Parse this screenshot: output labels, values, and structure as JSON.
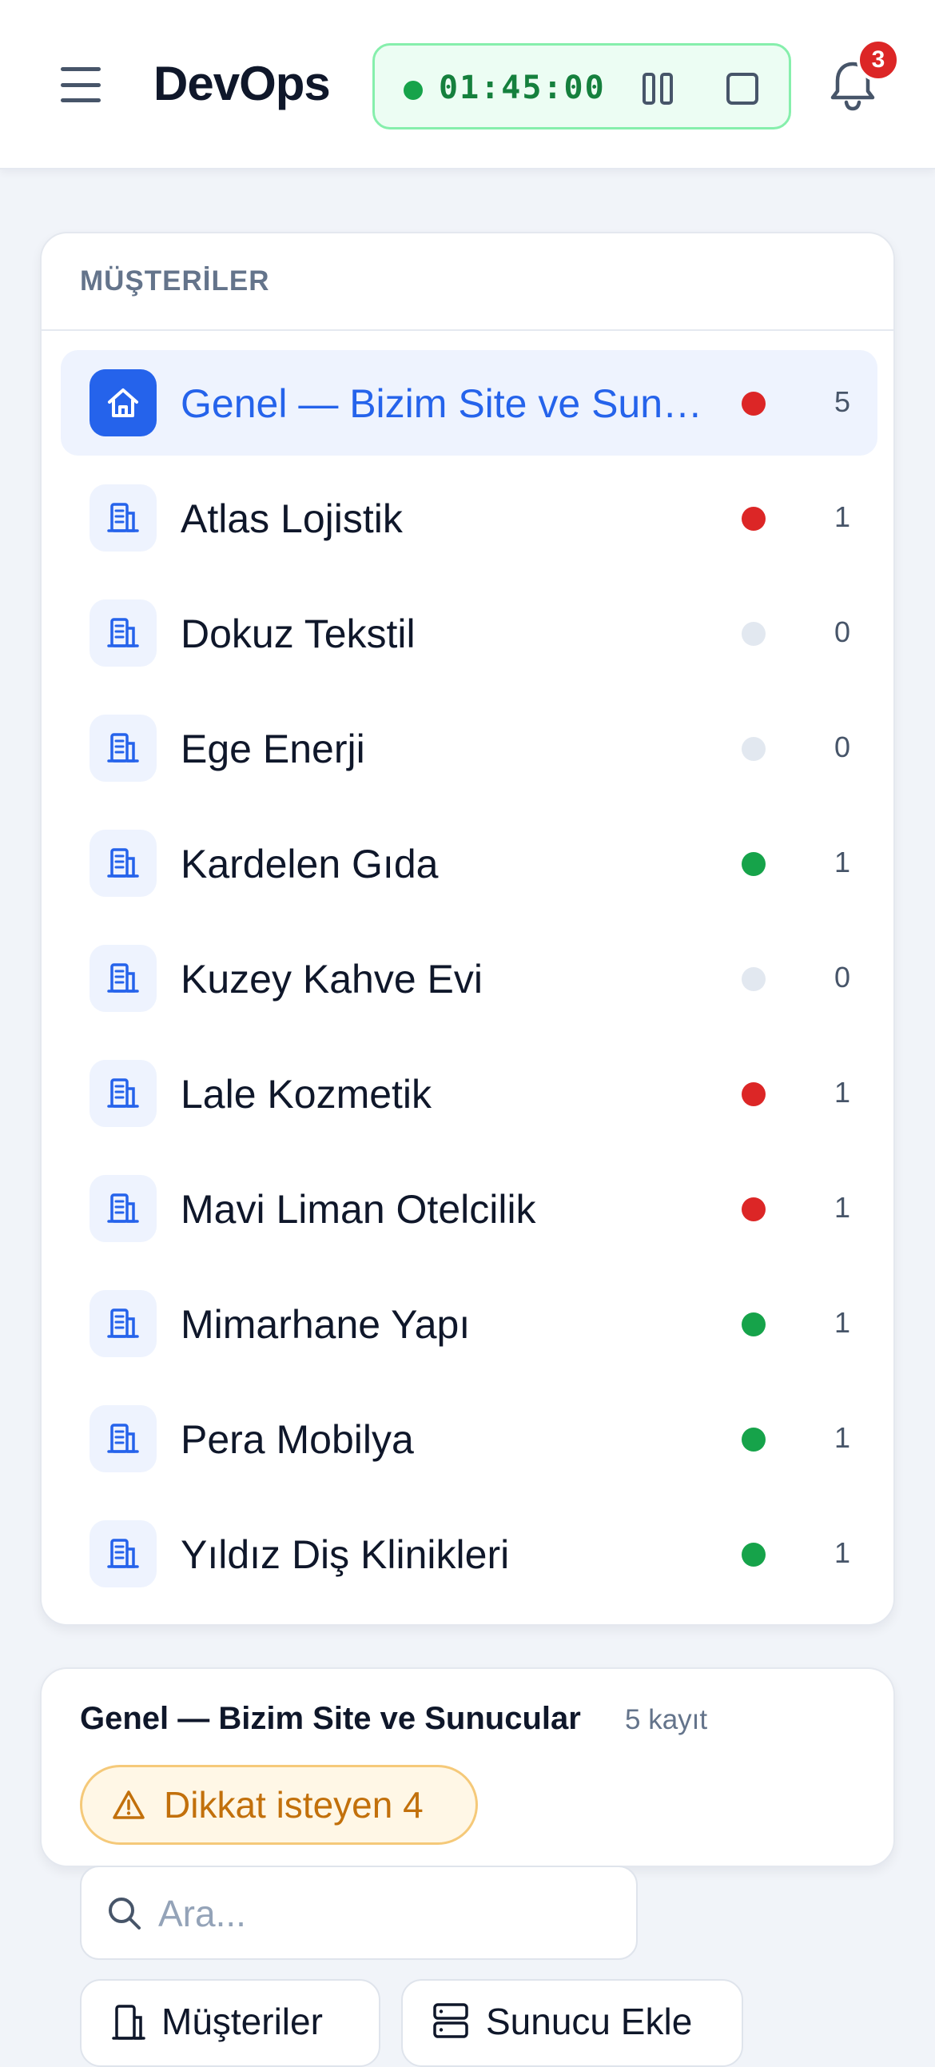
{
  "header": {
    "brand": "DevOps",
    "timer": "01:45:00",
    "notifications_count": "3"
  },
  "customers": {
    "heading": "MÜŞTERİLER",
    "items": [
      {
        "label": "Genel — Bizim Site ve Sunucular",
        "count": "5",
        "status": "red",
        "icon": "home-icon",
        "active": true
      },
      {
        "label": "Atlas Lojistik",
        "count": "1",
        "status": "red",
        "icon": "building-icon",
        "active": false
      },
      {
        "label": "Dokuz Tekstil",
        "count": "0",
        "status": "none",
        "icon": "building-icon",
        "active": false
      },
      {
        "label": "Ege Enerji",
        "count": "0",
        "status": "none",
        "icon": "building-icon",
        "active": false
      },
      {
        "label": "Kardelen Gıda",
        "count": "1",
        "status": "green",
        "icon": "building-icon",
        "active": false
      },
      {
        "label": "Kuzey Kahve Evi",
        "count": "0",
        "status": "none",
        "icon": "building-icon",
        "active": false
      },
      {
        "label": "Lale Kozmetik",
        "count": "1",
        "status": "red",
        "icon": "building-icon",
        "active": false
      },
      {
        "label": "Mavi Liman Otelcilik",
        "count": "1",
        "status": "red",
        "icon": "building-icon",
        "active": false
      },
      {
        "label": "Mimarhane Yapı",
        "count": "1",
        "status": "green",
        "icon": "building-icon",
        "active": false
      },
      {
        "label": "Pera Mobilya",
        "count": "1",
        "status": "green",
        "icon": "building-icon",
        "active": false
      },
      {
        "label": "Yıldız Diş Klinikleri",
        "count": "1",
        "status": "green",
        "icon": "building-icon",
        "active": false
      }
    ]
  },
  "detail": {
    "title": "Genel — Bizim Site ve Sunucular",
    "record_count": "5 kayıt",
    "attention_label": "Dikkat isteyen 4"
  },
  "search": {
    "placeholder": "Ara..."
  },
  "actions": {
    "customers_label": "Müşteriler",
    "add_server_label": "Sunucu Ekle"
  },
  "colors": {
    "accent": "#2563eb",
    "status_red": "#dc2626",
    "status_green": "#16a34a",
    "status_none": "#e2e8f0",
    "timer_green": "#15803d",
    "warning": "#c2700b"
  }
}
